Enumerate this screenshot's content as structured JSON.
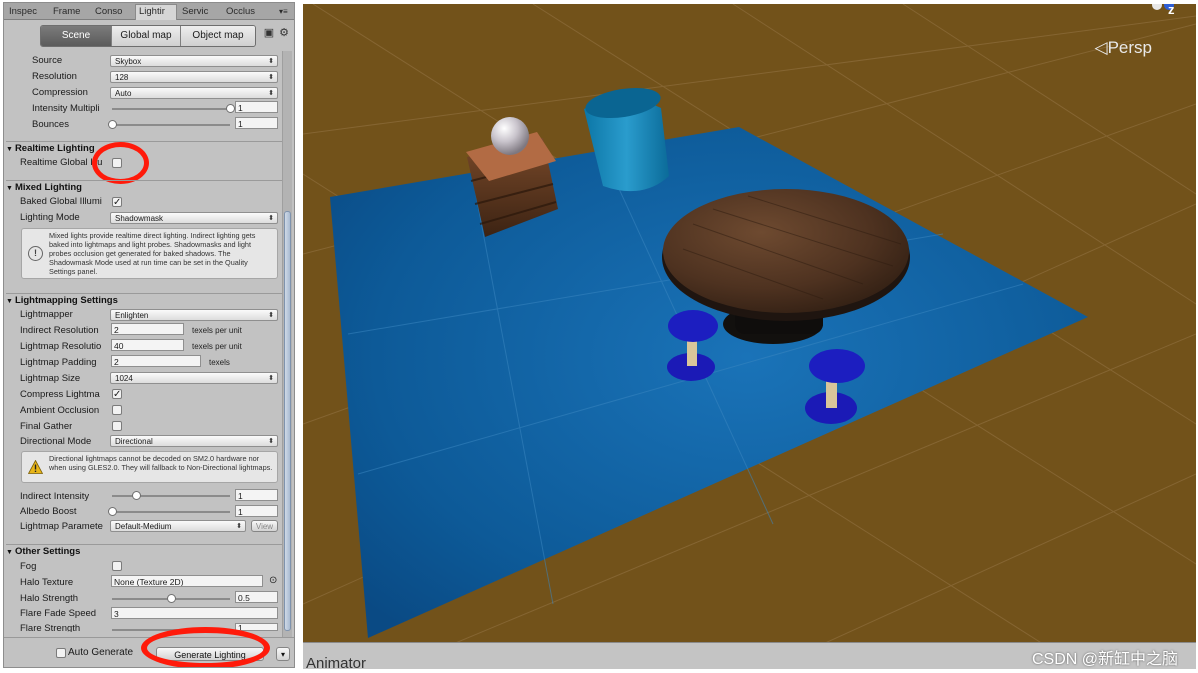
{
  "tabs": [
    "Inspec",
    "Frame",
    "Conso",
    "Lightir",
    "Servic",
    "Occlus"
  ],
  "subtabs": [
    "Scene",
    "Global map",
    "Object map"
  ],
  "environment": {
    "source_label": "Source",
    "source_value": "Skybox",
    "resolution_label": "Resolution",
    "resolution_value": "128",
    "compression_label": "Compression",
    "compression_value": "Auto",
    "intensity_label": "Intensity Multipli",
    "intensity_value": "1",
    "bounces_label": "Bounces",
    "bounces_value": "1"
  },
  "realtime": {
    "title": "Realtime Lighting",
    "gi_label": "Realtime Global Illu"
  },
  "mixed": {
    "title": "Mixed Lighting",
    "baked_label": "Baked Global Illumi",
    "mode_label": "Lighting Mode",
    "mode_value": "Shadowmask",
    "help": "Mixed lights provide realtime direct lighting. Indirect lighting gets baked into lightmaps and light probes. Shadowmasks and light probes occlusion get generated for baked shadows. The Shadowmask Mode used at run time can be set in the Quality Settings panel."
  },
  "lightmapping": {
    "title": "Lightmapping Settings",
    "lightmapper_label": "Lightmapper",
    "lightmapper_value": "Enlighten",
    "indirect_res_label": "Indirect Resolution",
    "indirect_res_value": "2",
    "indirect_res_unit": "texels per unit",
    "lightmap_res_label": "Lightmap Resolutio",
    "lightmap_res_value": "40",
    "lightmap_res_unit": "texels per unit",
    "padding_label": "Lightmap Padding",
    "padding_value": "2",
    "padding_unit": "texels",
    "size_label": "Lightmap Size",
    "size_value": "1024",
    "compress_label": "Compress Lightma",
    "ao_label": "Ambient Occlusion",
    "final_gather_label": "Final Gather",
    "dir_mode_label": "Directional Mode",
    "dir_mode_value": "Directional",
    "warning": "Directional lightmaps cannot be decoded on SM2.0 hardware nor when using GLES2.0. They will fallback to Non-Directional lightmaps.",
    "indirect_int_label": "Indirect Intensity",
    "indirect_int_value": "1",
    "albedo_label": "Albedo Boost",
    "albedo_value": "1",
    "params_label": "Lightmap Paramete",
    "params_value": "Default-Medium",
    "view_label": "View"
  },
  "other": {
    "title": "Other Settings",
    "fog_label": "Fog",
    "halo_tex_label": "Halo Texture",
    "halo_tex_value": "None (Texture 2D)",
    "halo_str_label": "Halo Strength",
    "halo_str_value": "0.5",
    "flare_fade_label": "Flare Fade Speed",
    "flare_fade_value": "3",
    "flare_str_label": "Flare Strength",
    "flare_str_value": "1"
  },
  "bottom": {
    "auto_label": "Auto Generate",
    "generate_label": "Generate Lighting"
  },
  "sliders": {
    "intensity": 1.0,
    "bounces": 0.0,
    "indirect_intensity": 0.2,
    "albedo_boost": 0.0,
    "halo_strength": 0.5,
    "flare_strength": 1.0
  },
  "scene": {
    "persp_label": "Persp",
    "gizmo_label": "z",
    "animator_label": "Animator",
    "watermark": "CSDN @新缸中之脑"
  },
  "colors": {
    "scene_bg": "#72521a",
    "floor": "#0f5f9b",
    "annotation": "#ff1a0a"
  }
}
